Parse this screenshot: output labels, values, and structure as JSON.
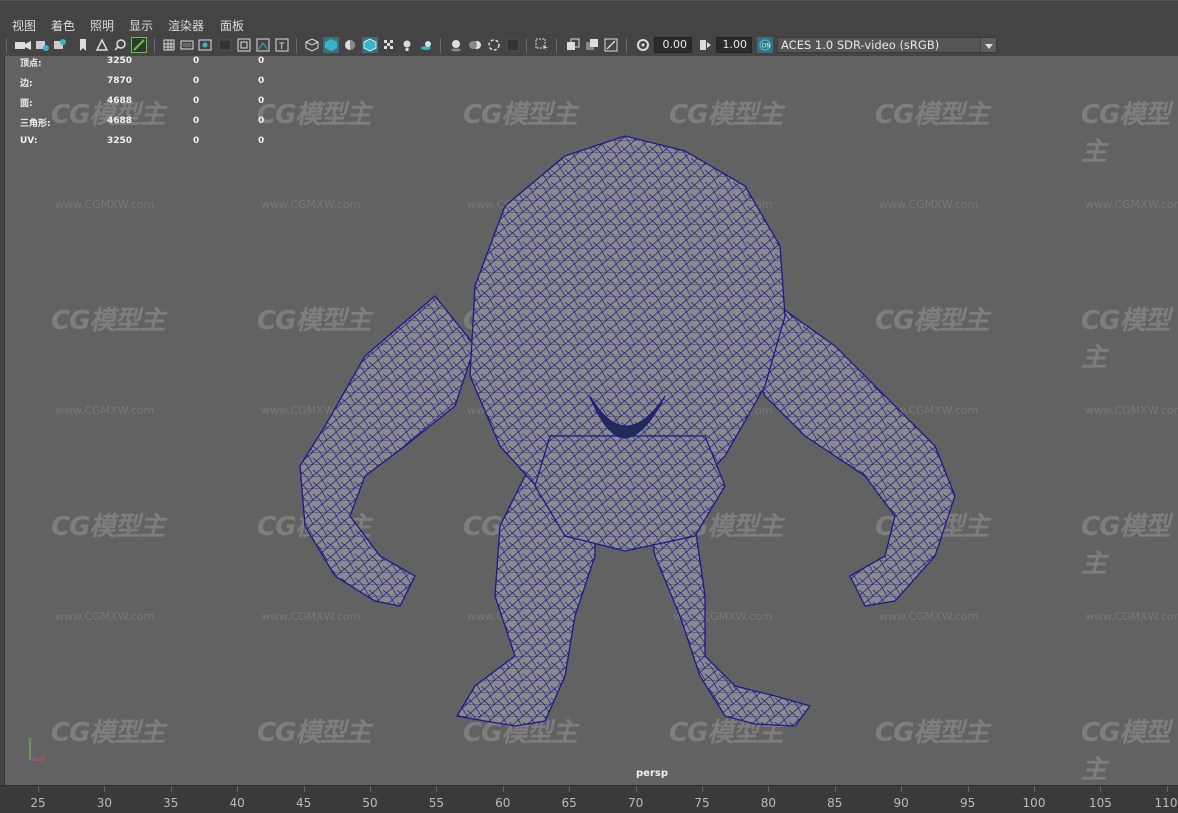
{
  "menu": {
    "items": [
      "视图",
      "着色",
      "照明",
      "显示",
      "渲染器",
      "面板"
    ]
  },
  "toolbar": {
    "exposure_value": "0.00",
    "gamma_value": "1.00",
    "color_space": "ACES 1.0 SDR-video (sRGB)",
    "accent_color": "#35b5c9"
  },
  "hud": {
    "rows": [
      {
        "label": "顶点:",
        "v1": "3250",
        "v2": "0",
        "v3": "0"
      },
      {
        "label": "边:",
        "v1": "7870",
        "v2": "0",
        "v3": "0"
      },
      {
        "label": "面:",
        "v1": "4688",
        "v2": "0",
        "v3": "0"
      },
      {
        "label": "三角形:",
        "v1": "4688",
        "v2": "0",
        "v3": "0"
      },
      {
        "label": "UV:",
        "v1": "3250",
        "v2": "0",
        "v3": "0"
      }
    ]
  },
  "viewport": {
    "camera_label": "persp",
    "watermark_text": "CG模型主",
    "watermark_url": "www.CGMXW.com",
    "mesh_fill": "#8a8a8a",
    "wire_color": "#1a1a8c"
  },
  "axis": {
    "x": "x",
    "y": "y"
  },
  "timeline": {
    "labels": [
      "25",
      "30",
      "35",
      "40",
      "45",
      "50",
      "55",
      "60",
      "65",
      "70",
      "75",
      "80",
      "85",
      "90",
      "95",
      "100",
      "105",
      "110"
    ]
  }
}
